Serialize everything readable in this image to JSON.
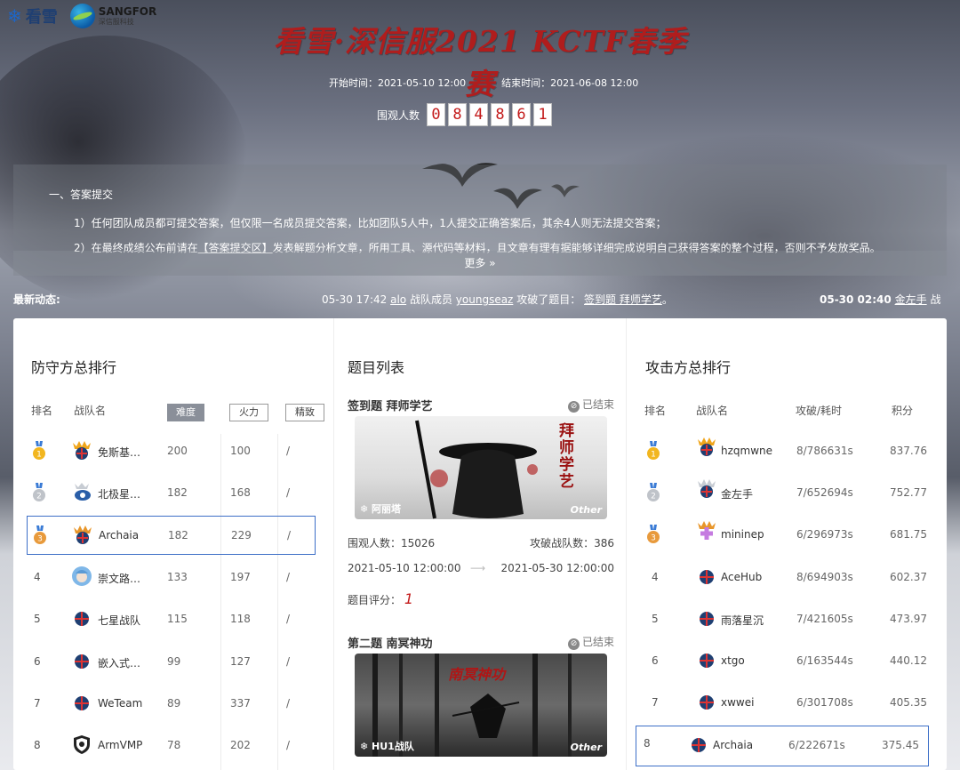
{
  "brand": {
    "kanxue": "看雪",
    "sangfor": "SANGFOR",
    "sangfor_sub": "深信服科技"
  },
  "title": "看雪·深信服2021 KCTF春季赛",
  "times": {
    "start": "开始时间：2021-05-10 12:00",
    "end": "结束时间：2021-06-08 12:00"
  },
  "viewers": {
    "label": "围观人数",
    "digits": [
      "0",
      "8",
      "4",
      "8",
      "6",
      "1"
    ]
  },
  "notice": {
    "heading": "一、答案提交",
    "line1": "1）任何团队成员都可提交答案，但仅限一名成员提交答案，比如团队5人中，1人提交正确答案后，其余4人则无法提交答案；",
    "line2_pre": "2）在最终成绩公布前请在",
    "line2_link": "【答案提交区】",
    "line2_post": "发表解题分析文章，所用工具、源代码等材料，且文章有理有据能够详细完成说明自己获得答案的整个过程，否则不予发放奖品。",
    "more": "更多 »"
  },
  "news": {
    "label": "最新动态:",
    "a_time": "05-30 17:42",
    "a_team": "alo",
    "a_mid": "战队成员",
    "a_user": "youngseaz",
    "a_action": "攻破了题目：",
    "a_problem": "签到题 拜师学艺",
    "a_end": "。",
    "b_time": "05-30 02:40",
    "b_team": "金左手",
    "b_mid": "战"
  },
  "defense": {
    "title": "防守方总排行",
    "headers": {
      "rank": "排名",
      "team": "战队名",
      "difficulty": "难度",
      "fire": "火力",
      "elite": "精致"
    },
    "rows": [
      {
        "rank": "1",
        "name": "免斯基…",
        "difficulty": "200",
        "fire": "100",
        "elite": "/"
      },
      {
        "rank": "2",
        "name": "北极星…",
        "difficulty": "182",
        "fire": "168",
        "elite": "/"
      },
      {
        "rank": "3",
        "name": "Archaia",
        "difficulty": "182",
        "fire": "229",
        "elite": "/"
      },
      {
        "rank": "4",
        "name": "崇文路…",
        "difficulty": "133",
        "fire": "197",
        "elite": "/"
      },
      {
        "rank": "5",
        "name": "七星战队",
        "difficulty": "115",
        "fire": "118",
        "elite": "/"
      },
      {
        "rank": "6",
        "name": "嵌入式…",
        "difficulty": "99",
        "fire": "127",
        "elite": "/"
      },
      {
        "rank": "7",
        "name": "WeTeam",
        "difficulty": "89",
        "fire": "337",
        "elite": "/"
      },
      {
        "rank": "8",
        "name": "ArmVMP",
        "difficulty": "78",
        "fire": "202",
        "elite": "/"
      }
    ]
  },
  "problems": {
    "title": "题目列表",
    "items": [
      {
        "title": "签到题 拜师学艺",
        "status": "已结束",
        "team": "阿丽塔",
        "category": "Other",
        "art_text": "拜师学艺",
        "viewers_label": "围观人数：",
        "viewers": "15026",
        "breakers_label": "攻破战队数：",
        "breakers": "386",
        "start": "2021-05-10 12:00:00",
        "end": "2021-05-30 12:00:00",
        "score_label": "题目评分：",
        "score": "1"
      },
      {
        "title": "第二题 南冥神功",
        "status": "已结束",
        "team": "HU1战队",
        "category": "Other",
        "art_text": "南冥神功"
      }
    ]
  },
  "attack": {
    "title": "攻击方总排行",
    "headers": {
      "rank": "排名",
      "team": "战队名",
      "breach": "攻破/耗时",
      "score": "积分"
    },
    "rows": [
      {
        "rank": "1",
        "name": "hzqmwne",
        "breach": "8/786631s",
        "score": "837.76"
      },
      {
        "rank": "2",
        "name": "金左手",
        "breach": "7/652694s",
        "score": "752.77"
      },
      {
        "rank": "3",
        "name": "mininep",
        "breach": "6/296973s",
        "score": "681.75"
      },
      {
        "rank": "4",
        "name": "AceHub",
        "breach": "8/694903s",
        "score": "602.37"
      },
      {
        "rank": "5",
        "name": "雨落星沉",
        "breach": "7/421605s",
        "score": "473.97"
      },
      {
        "rank": "6",
        "name": "xtgo",
        "breach": "6/163544s",
        "score": "440.12"
      },
      {
        "rank": "7",
        "name": "xwwei",
        "breach": "6/301708s",
        "score": "405.35"
      },
      {
        "rank": "8",
        "name": "Archaia",
        "breach": "6/222671s",
        "score": "375.45"
      }
    ]
  },
  "colors": {
    "accent_red": "#b01d1d",
    "highlight_border": "#3d6fc7",
    "gold": "#f2b61f",
    "silver": "#bfc3c9",
    "bronze": "#e89a3c"
  }
}
